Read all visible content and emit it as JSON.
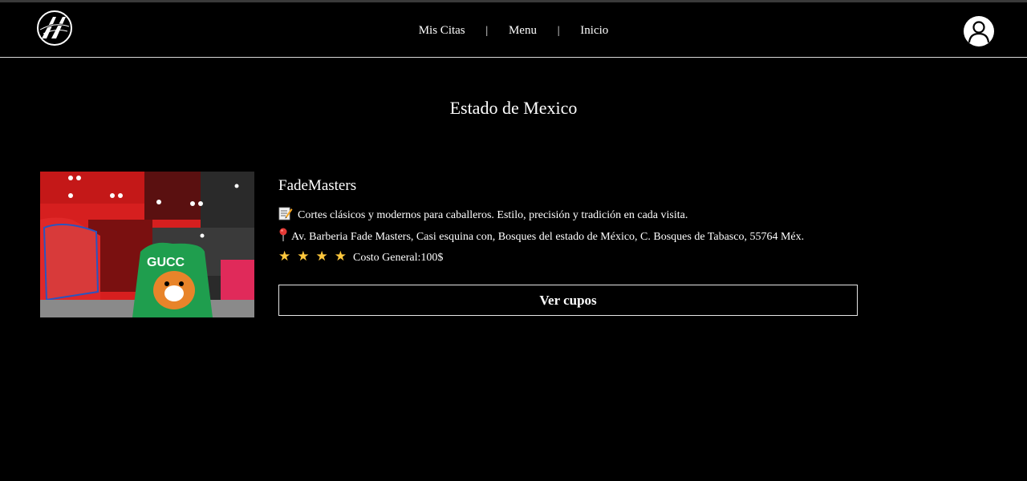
{
  "colors": {
    "background": "#000000",
    "text": "#ffffff",
    "star": "#ffc83d",
    "divider": "#d9d9d9"
  },
  "header": {
    "logo_icon": "barber-logo-icon",
    "nav": [
      "Mis Citas",
      "Menu",
      "Inicio"
    ],
    "separator": "|",
    "avatar_icon": "user-avatar-icon"
  },
  "main": {
    "title": "Estado de Mexico",
    "shop": {
      "name": "FadeMasters",
      "description_icon": "memo-icon",
      "description": "Cortes clásicos y modernos para caballeros. Estilo, precisión y tradición en cada visita.",
      "address_icon": "map-pin-icon",
      "address": "Av. Barberia Fade Masters, Casi esquina con, Bosques del estado de México, C. Bosques de Tabasco, 55764 Méx.",
      "rating": 4,
      "rating_max": 4,
      "cost": "Costo General:100$",
      "button_label": "Ver cupos",
      "photo": "barbershop-photo"
    }
  }
}
